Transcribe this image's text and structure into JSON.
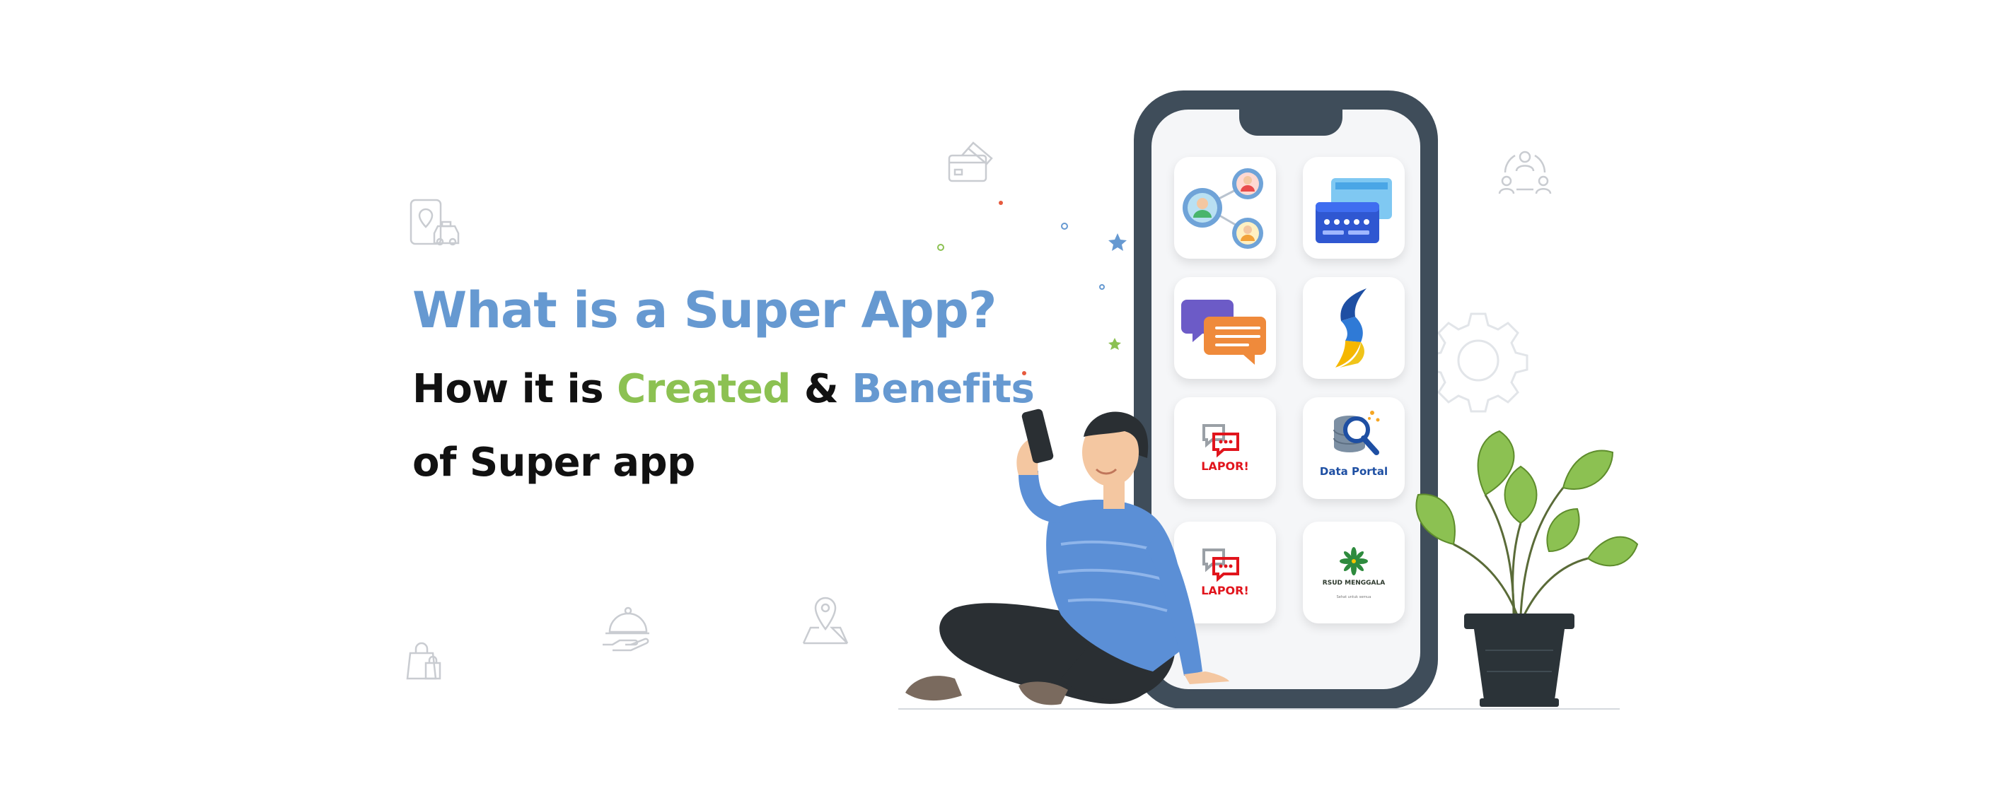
{
  "headline": "What is a Super App?",
  "subheadline": {
    "part1": "How it is ",
    "created": "Created",
    "part2": " & ",
    "benefits": "Benefits",
    "line3": "of Super app"
  },
  "colors": {
    "blue_accent": "#6699d1",
    "green_accent": "#8cc152",
    "text_dark": "#111111",
    "phone_frame": "#3f4d5a",
    "lapor_red": "#e1141c",
    "data_portal_blue": "#1e4fa3"
  },
  "phone_apps": [
    {
      "icon": "people-network-icon"
    },
    {
      "icon": "id-card-icon"
    },
    {
      "icon": "chat-bubbles-icon"
    },
    {
      "icon": "s-logo-icon"
    },
    {
      "icon": "lapor-logo-icon",
      "label": "LAPOR!"
    },
    {
      "icon": "data-portal-icon",
      "label": "Data Portal"
    },
    {
      "icon": "lapor-logo-icon",
      "label": "LAPOR!"
    },
    {
      "icon": "rsud-menggala-logo-icon",
      "label": "RSUD MENGGALA",
      "tagline": "Sehat untuk semua"
    }
  ],
  "decorative_icons": [
    "map-taxi-icon",
    "credit-card-icon",
    "team-network-icon",
    "shopping-bag-icon",
    "food-cloche-icon",
    "map-pin-icon",
    "gear-outline-icon"
  ]
}
